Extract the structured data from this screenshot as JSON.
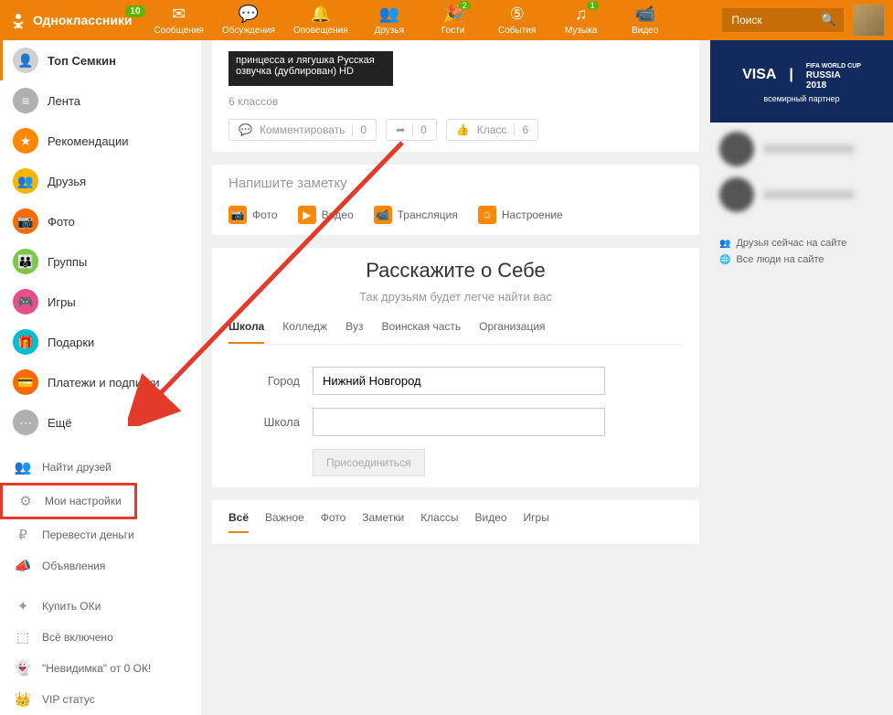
{
  "site_name": "Одноклассники",
  "logo_badge": "10",
  "nav": [
    {
      "label": "Сообщения",
      "icon": "✉"
    },
    {
      "label": "Обсуждения",
      "icon": "💬"
    },
    {
      "label": "Оповещения",
      "icon": "🔔"
    },
    {
      "label": "Друзья",
      "icon": "👥"
    },
    {
      "label": "Гости",
      "icon": "🎉",
      "badge": "2"
    },
    {
      "label": "События",
      "icon": "⑤"
    },
    {
      "label": "Музыка",
      "icon": "♫",
      "badge": "1"
    },
    {
      "label": "Видео",
      "icon": "📹"
    }
  ],
  "search_placeholder": "Поиск",
  "sidebar_main": [
    {
      "label": "Топ Семкин",
      "color": "#d0d0d0",
      "icon": "👤",
      "active": true
    },
    {
      "label": "Лента",
      "color": "#b0b0b0",
      "icon": "≡"
    },
    {
      "label": "Рекомендации",
      "color": "#ff8800",
      "icon": "★"
    },
    {
      "label": "Друзья",
      "color": "#f7b500",
      "icon": "👥"
    },
    {
      "label": "Фото",
      "color": "#ff6a00",
      "icon": "📷"
    },
    {
      "label": "Группы",
      "color": "#7ac943",
      "icon": "👪"
    },
    {
      "label": "Игры",
      "color": "#e5508c",
      "icon": "🎮"
    },
    {
      "label": "Подарки",
      "color": "#00bcd4",
      "icon": "🎁"
    },
    {
      "label": "Платежи и подписки",
      "color": "#ff6a00",
      "icon": "💳"
    },
    {
      "label": "Ещё",
      "color": "#b0b0b0",
      "icon": "⋯"
    }
  ],
  "sidebar_secondary": [
    {
      "label": "Найти друзей",
      "icon": "👥"
    },
    {
      "label": "Мои настройки",
      "icon": "⚙",
      "highlight": true
    },
    {
      "label": "Перевести деньги",
      "icon": "₽"
    },
    {
      "label": "Объявления",
      "icon": "📣"
    }
  ],
  "sidebar_tertiary": [
    {
      "label": "Купить ОКи",
      "icon": "✦"
    },
    {
      "label": "Всё включено",
      "icon": "⬚"
    },
    {
      "label": "\"Невидимка\" от 0 ОК!",
      "icon": "👻"
    },
    {
      "label": "VIP статус",
      "icon": "👑"
    }
  ],
  "post": {
    "title": "принцесса и лягушка Русская озвучка (дублирован) HD",
    "classes": "6 классов",
    "comment_label": "Комментировать",
    "comment_count": "0",
    "share_count": "0",
    "klass_label": "Класс",
    "klass_count": "6"
  },
  "note": {
    "hint": "Напишите заметку",
    "attachments": [
      {
        "label": "Фото",
        "icon": "📷"
      },
      {
        "label": "Видео",
        "icon": "▶"
      },
      {
        "label": "Трансляция",
        "icon": "📹"
      },
      {
        "label": "Настроение",
        "icon": "☺"
      }
    ]
  },
  "about": {
    "title": "Расскажите о Себе",
    "subtitle": "Так друзьям будет легче найти вас",
    "tabs": [
      "Школа",
      "Колледж",
      "Вуз",
      "Воинская часть",
      "Организация"
    ],
    "city_label": "Город",
    "city_value": "Нижний Новгород",
    "school_label": "Школа",
    "school_value": "",
    "join_button": "Присоединиться"
  },
  "filters": [
    "Всё",
    "Важное",
    "Фото",
    "Заметки",
    "Классы",
    "Видео",
    "Игры"
  ],
  "promo": {
    "brand1": "VISA",
    "brand2_top": "FIFA WORLD CUP",
    "brand2_main": "RUSSIA",
    "brand2_year": "2018",
    "tagline": "всемирный партнер"
  },
  "online": {
    "link1": "Друзья сейчас на сайте",
    "link2": "Все люди на сайте"
  }
}
